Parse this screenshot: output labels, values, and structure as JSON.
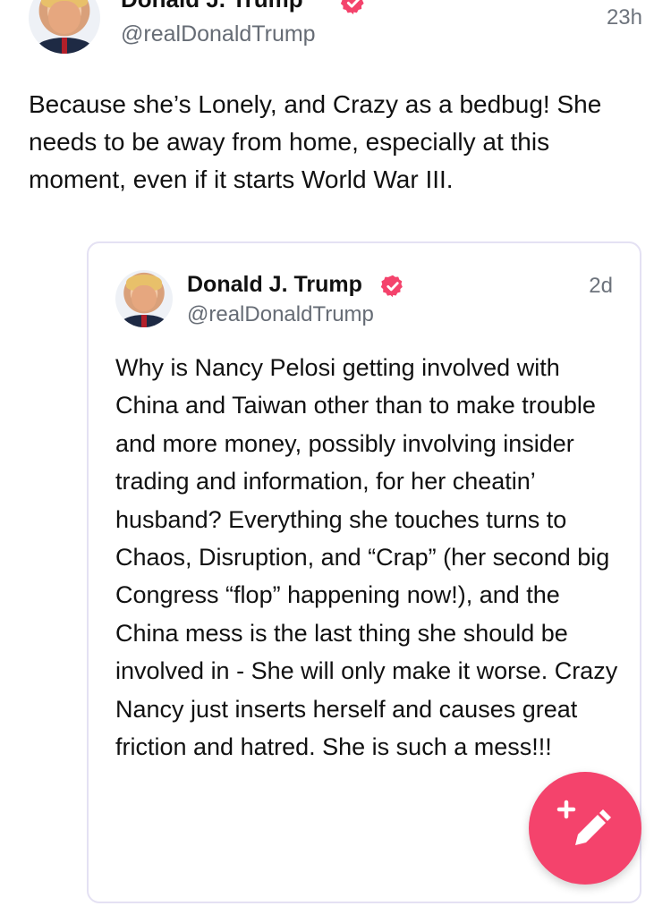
{
  "post": {
    "author_name": "Donald J. Trump",
    "handle": "@realDonaldTrump",
    "time": "23h",
    "text": "Because she’s Lonely, and Crazy as a bedbug! She needs to be away from home, especially at this moment, even if it starts World War III."
  },
  "quoted_post": {
    "author_name": "Donald J. Trump",
    "handle": "@realDonaldTrump",
    "time": "2d",
    "text": "Why is Nancy Pelosi getting involved with China and Taiwan other than to make trouble and more money, possibly involving insider trading and information, for her cheatin’ husband? Everything she touches turns to Chaos, Disruption, and “Crap” (her second big Congress “flop” happening now!), and the China mess is the last thing she should be involved in - She will only make it worse. Crazy Nancy just inserts herself and causes great friction and hatred. She is such a mess!!!"
  },
  "icons": {
    "verified": "verified-badge-icon",
    "compose": "compose-pencil-plus-icon"
  },
  "colors": {
    "accent": "#f4436c",
    "verified": "#f4436c",
    "muted_text": "#666c75",
    "card_border": "#e4e1f3"
  }
}
